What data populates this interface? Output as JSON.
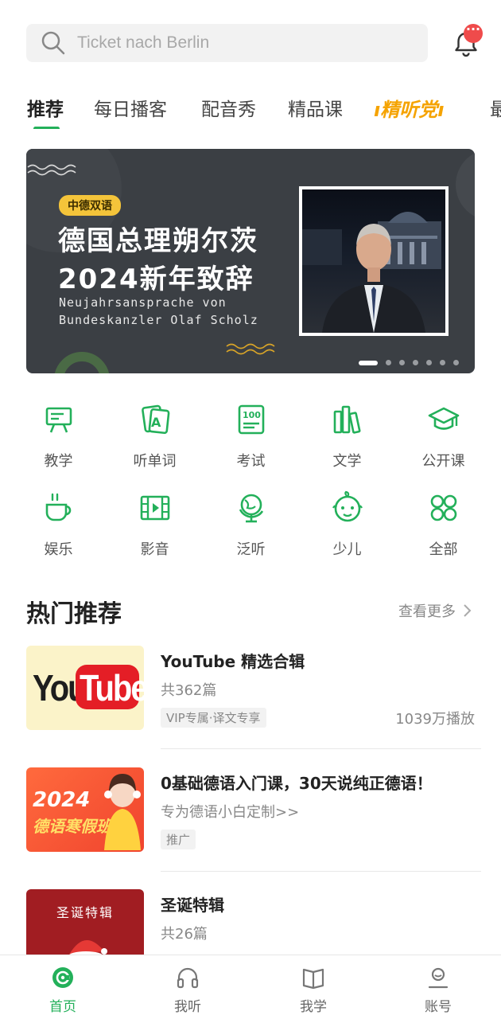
{
  "search": {
    "placeholder": "Ticket nach Berlin"
  },
  "notifications": {
    "badge": "···"
  },
  "tabs": [
    "推荐",
    "每日播客",
    "配音秀",
    "精品课",
    "精听党",
    "最"
  ],
  "banner": {
    "tag": "中德双语",
    "title_line1": "德国总理朔尔茨",
    "title_line2": "2024新年致辞",
    "subtitle_line1": "Neujahrsansprache von",
    "subtitle_line2": "Bundeskanzler Olaf Scholz",
    "slides": 7,
    "active_slide": 1
  },
  "categories": [
    {
      "label": "教学",
      "icon": "teaching-board-icon"
    },
    {
      "label": "听单词",
      "icon": "word-card-icon"
    },
    {
      "label": "考试",
      "icon": "exam-100-icon"
    },
    {
      "label": "文学",
      "icon": "books-icon"
    },
    {
      "label": "公开课",
      "icon": "graduation-cap-icon"
    },
    {
      "label": "娱乐",
      "icon": "coffee-cup-icon"
    },
    {
      "label": "影音",
      "icon": "film-icon"
    },
    {
      "label": "泛听",
      "icon": "globe-icon"
    },
    {
      "label": "少儿",
      "icon": "baby-face-icon"
    },
    {
      "label": "全部",
      "icon": "grid-all-icon"
    }
  ],
  "section": {
    "title": "热门推荐",
    "more": "查看更多"
  },
  "items": [
    {
      "title": "YouTube 精选合辑",
      "sub": "共362篇",
      "chip": "VIP专属·译文专享",
      "plays": "1039万播放",
      "thumb_text_1": "You",
      "thumb_text_2": "Tube"
    },
    {
      "title": "0基础德语入门课，30天说纯正德语！",
      "sub": "专为德语小白定制>>",
      "chip": "推广",
      "plays": "",
      "thumb_text_1": "2024",
      "thumb_text_2": "德语寒假班"
    },
    {
      "title": "圣诞特辑",
      "sub": "共26篇",
      "chip": "",
      "plays": "",
      "thumb_text_1": "圣诞特辑",
      "thumb_text_2": ""
    }
  ],
  "nav": [
    {
      "label": "首页",
      "active": true
    },
    {
      "label": "我听",
      "active": false
    },
    {
      "label": "我学",
      "active": false
    },
    {
      "label": "账号",
      "active": false
    }
  ],
  "colors": {
    "accent": "#23b05a",
    "badge": "#ef4b4b",
    "banner_bg": "#3b3f44",
    "tag": "#f4c43a"
  }
}
